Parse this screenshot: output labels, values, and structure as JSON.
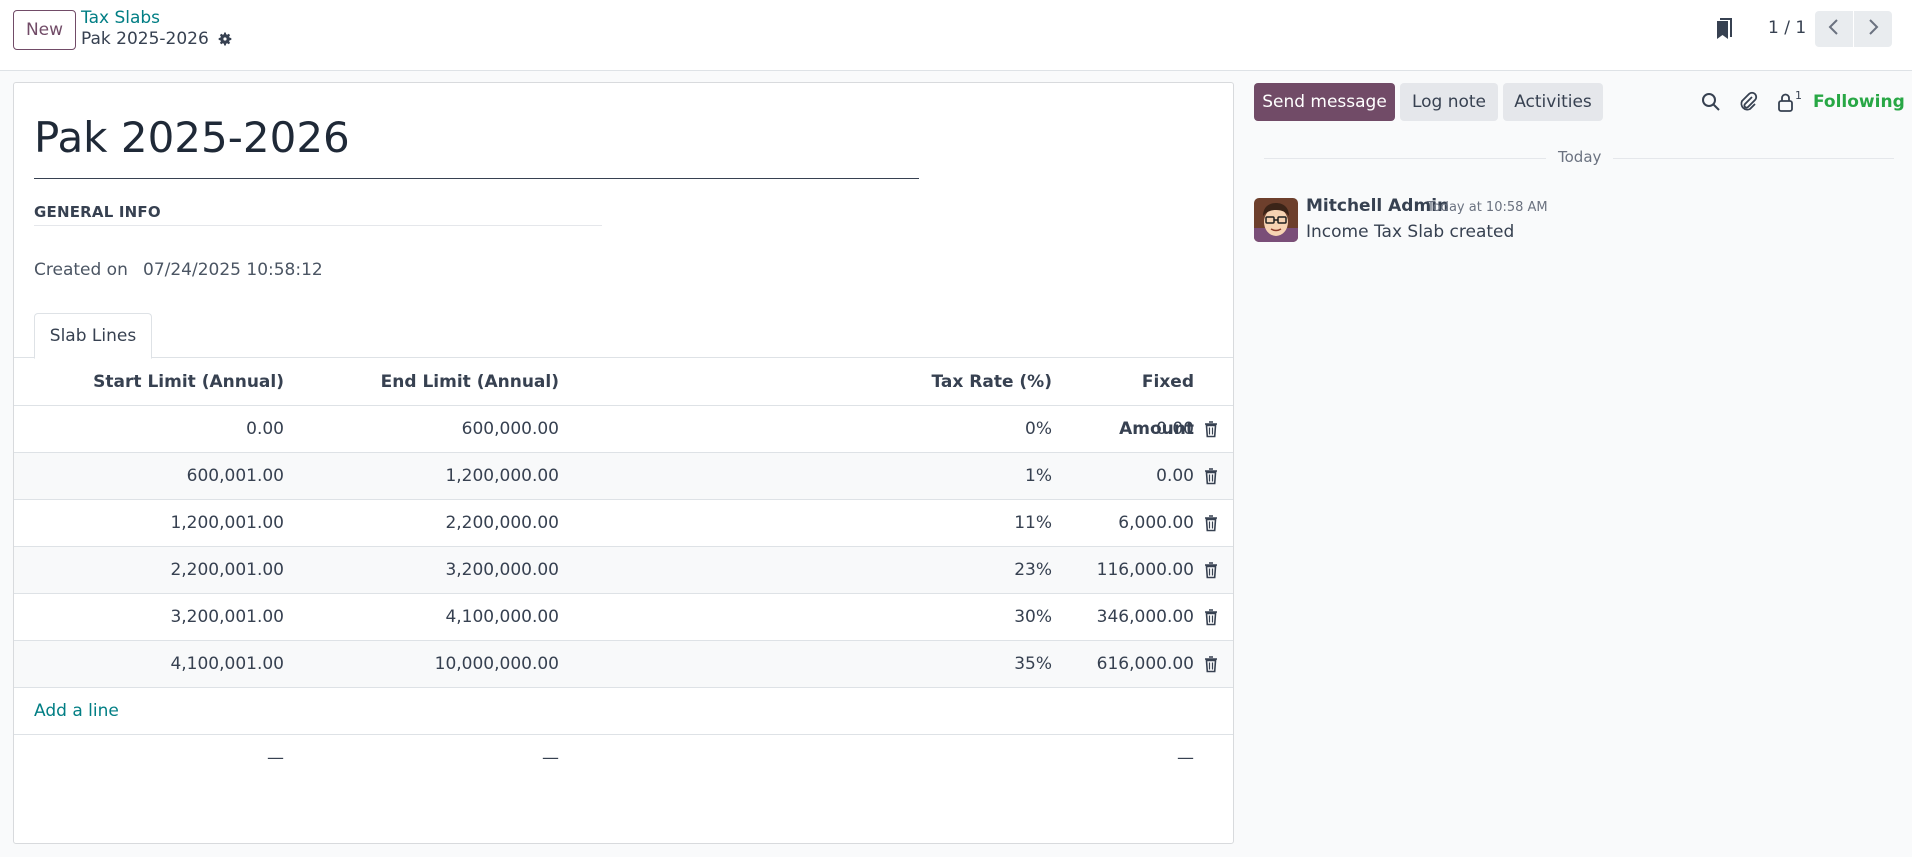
{
  "control_panel": {
    "new_label": "New",
    "breadcrumb_parent": "Tax Slabs",
    "breadcrumb_current": "Pak 2025-2026",
    "pager_value": "1 / 1"
  },
  "form": {
    "title": "Pak 2025-2026",
    "section_label": "GENERAL INFO",
    "created_on_label": "Created on",
    "created_on_value": "07/24/2025 10:58:12",
    "tab_label": "Slab Lines",
    "columns": [
      "Start Limit (Annual)",
      "End Limit (Annual)",
      "Tax Rate (%)",
      "Fixed Amount"
    ],
    "rows": [
      {
        "start": "0.00",
        "end": "600,000.00",
        "rate": "0%",
        "fixed": "0.00"
      },
      {
        "start": "600,001.00",
        "end": "1,200,000.00",
        "rate": "1%",
        "fixed": "0.00"
      },
      {
        "start": "1,200,001.00",
        "end": "2,200,000.00",
        "rate": "11%",
        "fixed": "6,000.00"
      },
      {
        "start": "2,200,001.00",
        "end": "3,200,000.00",
        "rate": "23%",
        "fixed": "116,000.00"
      },
      {
        "start": "3,200,001.00",
        "end": "4,100,000.00",
        "rate": "30%",
        "fixed": "346,000.00"
      },
      {
        "start": "4,100,001.00",
        "end": "10,000,000.00",
        "rate": "35%",
        "fixed": "616,000.00"
      }
    ],
    "add_line_label": "Add a line",
    "totals": {
      "start": "—",
      "end": "—",
      "fixed": "—"
    }
  },
  "chatter": {
    "send_message_label": "Send message",
    "log_note_label": "Log note",
    "activities_label": "Activities",
    "follower_count": "1",
    "following_label": "Following",
    "date_separator": "Today",
    "message": {
      "author": "Mitchell Admin",
      "date": "Today at 10:58 AM",
      "body": "Income Tax Slab created"
    }
  },
  "colors": {
    "brand": "#714b67",
    "link": "#017e84",
    "following": "#28a745"
  },
  "icons": [
    "gear-icon",
    "bookmark-icon",
    "chevron-left-icon",
    "chevron-right-icon",
    "trash-icon",
    "search-icon",
    "paperclip-icon",
    "lock-user-icon"
  ]
}
